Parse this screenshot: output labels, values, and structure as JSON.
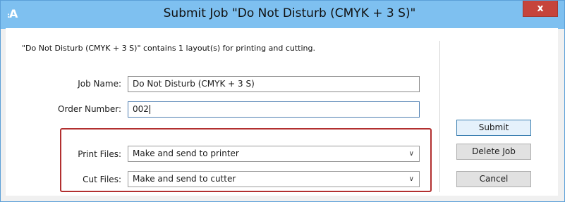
{
  "window": {
    "app_icon_label": "A",
    "title": "Submit Job \"Do Not Disturb (CMYK + 3 S)\"",
    "close_glyph": "x"
  },
  "message": "\"Do Not Disturb (CMYK + 3 S)\" contains 1 layout(s) for printing and cutting.",
  "fields": {
    "job_name": {
      "label": "Job Name:",
      "value": "Do Not Disturb (CMYK + 3 S)"
    },
    "order_number": {
      "label": "Order Number:",
      "value": "002"
    },
    "print_files": {
      "label": "Print Files:",
      "value": "Make and send to printer"
    },
    "cut_files": {
      "label": "Cut Files:",
      "value": "Make and send to cutter"
    }
  },
  "buttons": {
    "submit": "Submit",
    "delete_job": "Delete Job",
    "cancel": "Cancel"
  },
  "icons": {
    "dropdown": "chevron-down-icon",
    "close": "close-icon"
  },
  "colors": {
    "titlebar": "#7ec0f0",
    "close_button": "#c6443b",
    "highlight_box": "#b22f2f",
    "default_button_border": "#3c7fb1"
  }
}
